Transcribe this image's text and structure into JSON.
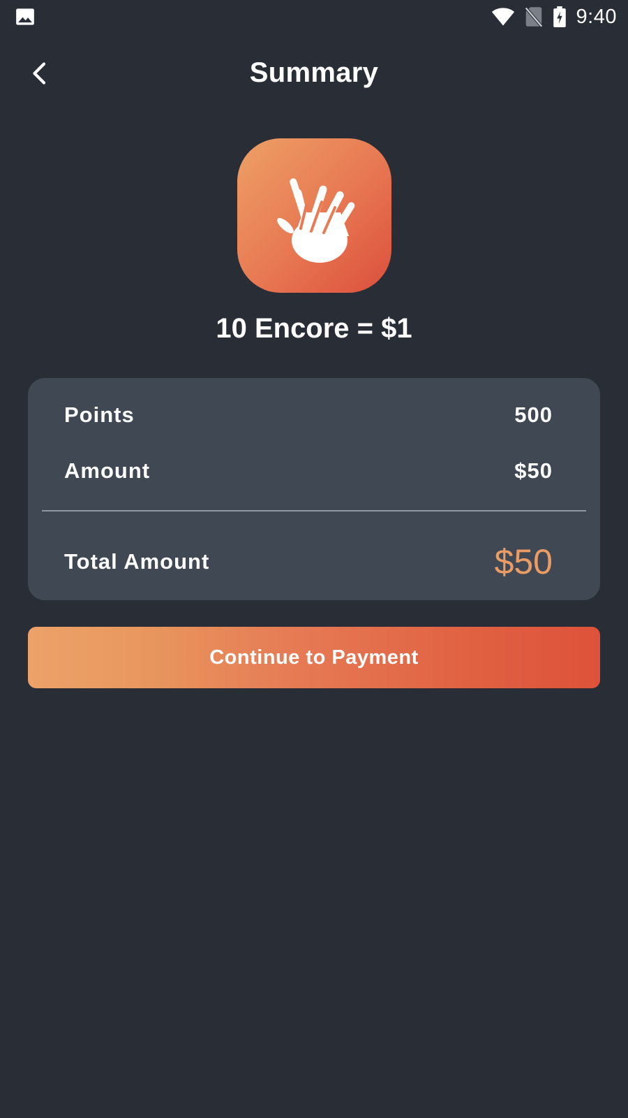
{
  "status_bar": {
    "time": "9:40",
    "icons": [
      "gallery-icon",
      "wifi-icon",
      "no-sim-icon",
      "battery-charging-icon"
    ]
  },
  "header": {
    "title": "Summary",
    "back_icon": "chevron-left-icon"
  },
  "hero": {
    "icon": "high-five-hand-icon",
    "rate": "10 Encore = $1"
  },
  "summary": {
    "rows": [
      {
        "label": "Points",
        "value": "500"
      },
      {
        "label": "Amount",
        "value": "$50"
      }
    ],
    "total": {
      "label": "Total Amount",
      "value": "$50"
    }
  },
  "actions": {
    "continue_label": "Continue to Payment"
  },
  "colors": {
    "background": "#292e36",
    "card": "#404953",
    "accent": "#eb9c64",
    "gradient_start": "#eca269",
    "gradient_end": "#de523a"
  }
}
